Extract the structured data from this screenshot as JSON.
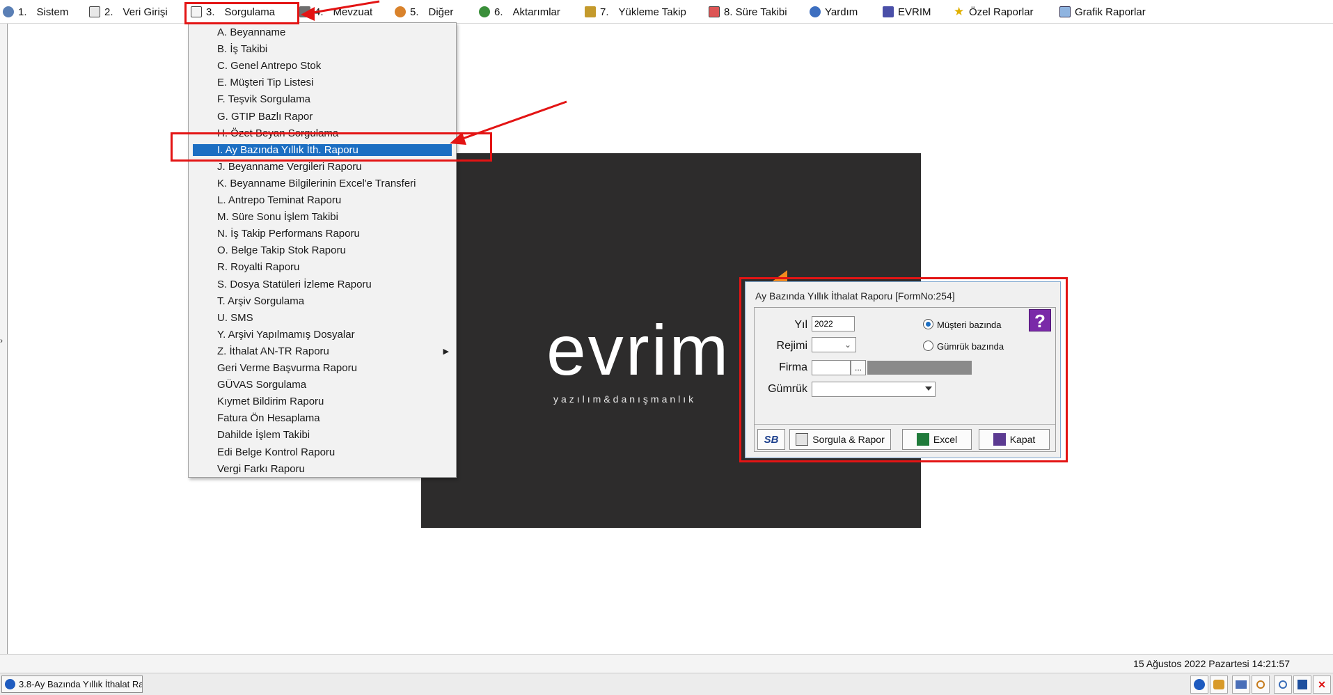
{
  "menubar": {
    "items": [
      {
        "num": "1.",
        "label": "Sistem",
        "icon": "system-icon"
      },
      {
        "num": "2.",
        "label": "Veri Girişi",
        "icon": "data-entry-icon"
      },
      {
        "num": "3.",
        "label": "Sorgulama",
        "icon": "query-icon"
      },
      {
        "num": "4.",
        "label": "Mevzuat",
        "icon": "legislation-icon"
      },
      {
        "num": "5.",
        "label": "Diğer",
        "icon": "other-icon"
      },
      {
        "num": "6.",
        "label": "Aktarımlar",
        "icon": "transfer-icon"
      },
      {
        "num": "7.",
        "label": "Yükleme Takip",
        "icon": "loading-track-icon"
      },
      {
        "num": "",
        "label": "8. Süre Takibi",
        "icon": "time-track-icon"
      },
      {
        "num": "",
        "label": "Yardım",
        "icon": "help-icon"
      },
      {
        "num": "",
        "label": "EVRIM",
        "icon": "evrim-icon"
      },
      {
        "num": "",
        "label": "Özel Raporlar",
        "icon": "star-icon"
      },
      {
        "num": "",
        "label": "Grafik Raporlar",
        "icon": "chart-icon"
      }
    ]
  },
  "dropdown": {
    "items": [
      "A.  Beyanname",
      "B.  İş Takibi",
      "C.  Genel Antrepo Stok",
      "E.  Müşteri Tip Listesi",
      "F.  Teşvik Sorgulama",
      "G.  GTIP Bazlı Rapor",
      "H.  Özet Beyan Sorgulama",
      "I.   Ay Bazında Yıllık İth. Raporu",
      "J.   Beyanname Vergileri Raporu",
      "K.  Beyanname Bilgilerinin Excel'e Transferi",
      "L.  Antrepo Teminat Raporu",
      "M.  Süre Sonu İşlem Takibi",
      "N.  İş Takip Performans Raporu",
      "O.  Belge Takip Stok Raporu",
      "R.  Royalti Raporu",
      "S.   Dosya Statüleri İzleme Raporu",
      "T.   Arşiv Sorgulama",
      "U.  SMS",
      "Y.  Arşivi Yapılmamış Dosyalar",
      "Z.  İthalat AN-TR Raporu",
      "Geri Verme Başvurma Raporu",
      "GÜVAS Sorgulama",
      "Kıymet Bildirim Raporu",
      "Fatura Ön Hesaplama",
      "Dahilde İşlem Takibi",
      "Edi Belge Kontrol Raporu",
      "Vergi Farkı Raporu"
    ],
    "selected_index": 7,
    "submenu_index": 19
  },
  "splash": {
    "logo": "evrim",
    "tagline": "yazılım&danışmanlık"
  },
  "dialog": {
    "title": "Ay Bazında Yıllık İthalat Raporu [FormNo:254]",
    "yil_label": "Yıl",
    "yil_value": "2022",
    "rejimi_label": "Rejimi",
    "firma_label": "Firma",
    "firma_button": "...",
    "gumruk_label": "Gümrük",
    "radio_musteri": "Müşteri bazında",
    "radio_gumruk": "Gümrük bazında",
    "selected_radio": "musteri",
    "help_badge": "?",
    "sb_button": "SB",
    "btn_sorgula": "Sorgula & Rapor",
    "btn_excel": "Excel",
    "btn_kapat": "Kapat"
  },
  "status": {
    "datetime": "15 Ağustos 2022 Pazartesi 14:21:57"
  },
  "taskbar": {
    "tab_label": "3.8-Ay Bazında Yıllık İthalat Ra"
  },
  "colors": {
    "annotation_red": "#e31414",
    "selection_blue": "#1b6ec2",
    "splash_bg": "#2d2c2c",
    "accent_orange": "#f28b1e"
  }
}
